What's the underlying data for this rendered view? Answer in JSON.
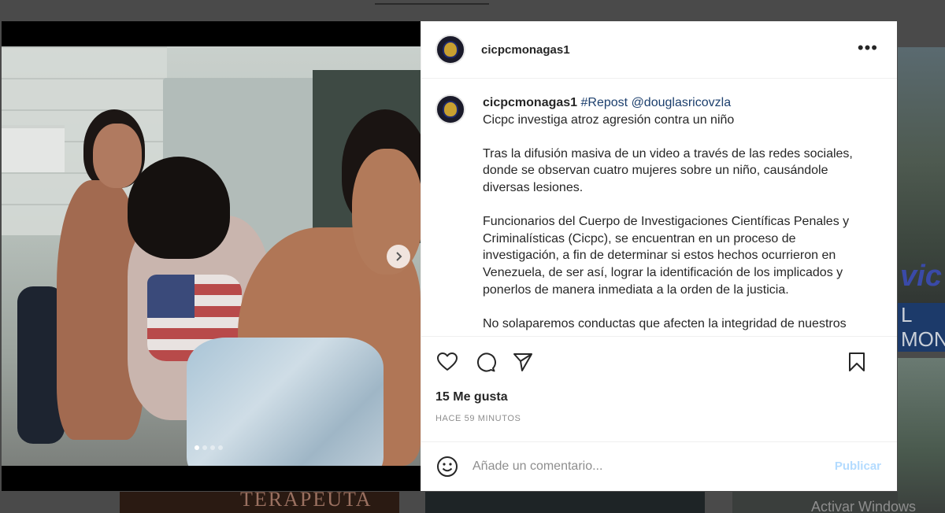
{
  "background": {
    "thumb_text": "TERAPEUTA",
    "watermark": "Activar Windows"
  },
  "post": {
    "username": "cicpcmonagas1",
    "more_icon": "more-horizontal-icon",
    "carousel": {
      "current": 1,
      "total": 4
    },
    "caption": {
      "username": "cicpcmonagas1",
      "hashtag": "#Repost",
      "mention": "@douglasricovzla",
      "title": "Cicpc investiga atroz agresión contra un niño",
      "paragraph1": "Tras la difusión masiva de un video a través de las redes sociales, donde se observan cuatro mujeres sobre un niño, causándole diversas lesiones.",
      "paragraph2": "Funcionarios del Cuerpo de Investigaciones Científicas Penales y Criminalísticas (Cicpc), se encuentran en un proceso de investigación, a fin de determinar si estos hechos ocurrieron en Venezuela, de ser así, lograr la identificación de los implicados y ponerlos de manera inmediata a la orden de la justicia.",
      "paragraph3": "No solaparemos conductas que afecten la integridad de nuestros"
    },
    "actions": {
      "like_icon": "heart-icon",
      "comment_icon": "comment-icon",
      "share_icon": "send-icon",
      "save_icon": "bookmark-icon"
    },
    "likes": "15 Me gusta",
    "time": "HACE 59 MINUTOS",
    "comment": {
      "placeholder": "Añade un comentario...",
      "publish_label": "Publicar",
      "publish_color": "#b3dbff"
    }
  }
}
